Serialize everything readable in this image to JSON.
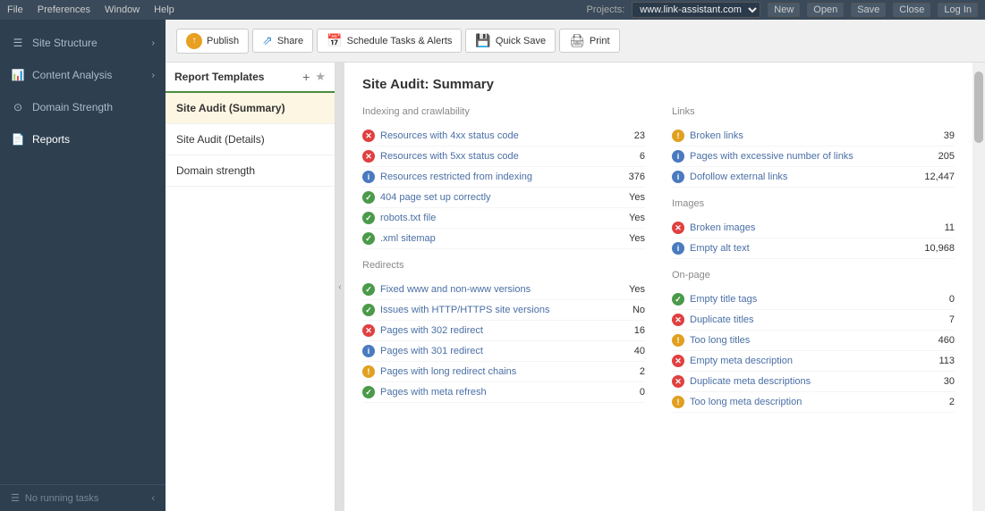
{
  "menubar": {
    "items": [
      "File",
      "Preferences",
      "Window",
      "Help"
    ],
    "project_label": "Projects:",
    "project_value": "www.link-assistant.com",
    "buttons": [
      "New",
      "Open",
      "Save",
      "Close",
      "Log In"
    ]
  },
  "toolbar": {
    "publish_label": "Publish",
    "share_label": "Share",
    "schedule_label": "Schedule Tasks & Alerts",
    "quicksave_label": "Quick Save",
    "print_label": "Print"
  },
  "sidebar": {
    "items": [
      {
        "id": "site-structure",
        "label": "Site Structure"
      },
      {
        "id": "content-analysis",
        "label": "Content Analysis"
      },
      {
        "id": "domain-strength",
        "label": "Domain Strength"
      },
      {
        "id": "reports",
        "label": "Reports"
      }
    ],
    "bottom": "No running tasks"
  },
  "templates": {
    "header": "Report Templates",
    "items": [
      {
        "id": "site-audit-summary",
        "label": "Site Audit (Summary)",
        "active": true
      },
      {
        "id": "site-audit-details",
        "label": "Site Audit (Details)",
        "active": false
      },
      {
        "id": "domain-strength",
        "label": "Domain strength",
        "active": false
      }
    ]
  },
  "report": {
    "title": "Site Audit: Summary",
    "sections": {
      "left": [
        {
          "title": "Indexing and crawlability",
          "rows": [
            {
              "status": "error",
              "label": "Resources with 4xx status code",
              "value": "23"
            },
            {
              "status": "error",
              "label": "Resources with 5xx status code",
              "value": "6"
            },
            {
              "status": "info",
              "label": "Resources restricted from indexing",
              "value": "376"
            },
            {
              "status": "ok",
              "label": "404 page set up correctly",
              "value": "Yes"
            },
            {
              "status": "ok",
              "label": "robots.txt file",
              "value": "Yes"
            },
            {
              "status": "ok",
              "label": ".xml sitemap",
              "value": "Yes"
            }
          ]
        },
        {
          "title": "Redirects",
          "rows": [
            {
              "status": "ok",
              "label": "Fixed www and non-www versions",
              "value": "Yes"
            },
            {
              "status": "ok",
              "label": "Issues with HTTP/HTTPS site versions",
              "value": "No"
            },
            {
              "status": "error",
              "label": "Pages with 302 redirect",
              "value": "16"
            },
            {
              "status": "info",
              "label": "Pages with 301 redirect",
              "value": "40"
            },
            {
              "status": "warn",
              "label": "Pages with long redirect chains",
              "value": "2"
            },
            {
              "status": "ok",
              "label": "Pages with meta refresh",
              "value": "0"
            }
          ]
        }
      ],
      "right": [
        {
          "title": "Links",
          "rows": [
            {
              "status": "warn",
              "label": "Broken links",
              "value": "39"
            },
            {
              "status": "info",
              "label": "Pages with excessive number of links",
              "value": "205"
            },
            {
              "status": "info",
              "label": "Dofollow external links",
              "value": "12,447"
            }
          ]
        },
        {
          "title": "Images",
          "rows": [
            {
              "status": "error",
              "label": "Broken images",
              "value": "11"
            },
            {
              "status": "info",
              "label": "Empty alt text",
              "value": "10,968"
            }
          ]
        },
        {
          "title": "On-page",
          "rows": [
            {
              "status": "ok",
              "label": "Empty title tags",
              "value": "0"
            },
            {
              "status": "error",
              "label": "Duplicate titles",
              "value": "7"
            },
            {
              "status": "warn",
              "label": "Too long titles",
              "value": "460"
            },
            {
              "status": "error",
              "label": "Empty meta description",
              "value": "113"
            },
            {
              "status": "error",
              "label": "Duplicate meta descriptions",
              "value": "30"
            },
            {
              "status": "warn",
              "label": "Too long meta description",
              "value": "2"
            }
          ]
        }
      ]
    }
  }
}
